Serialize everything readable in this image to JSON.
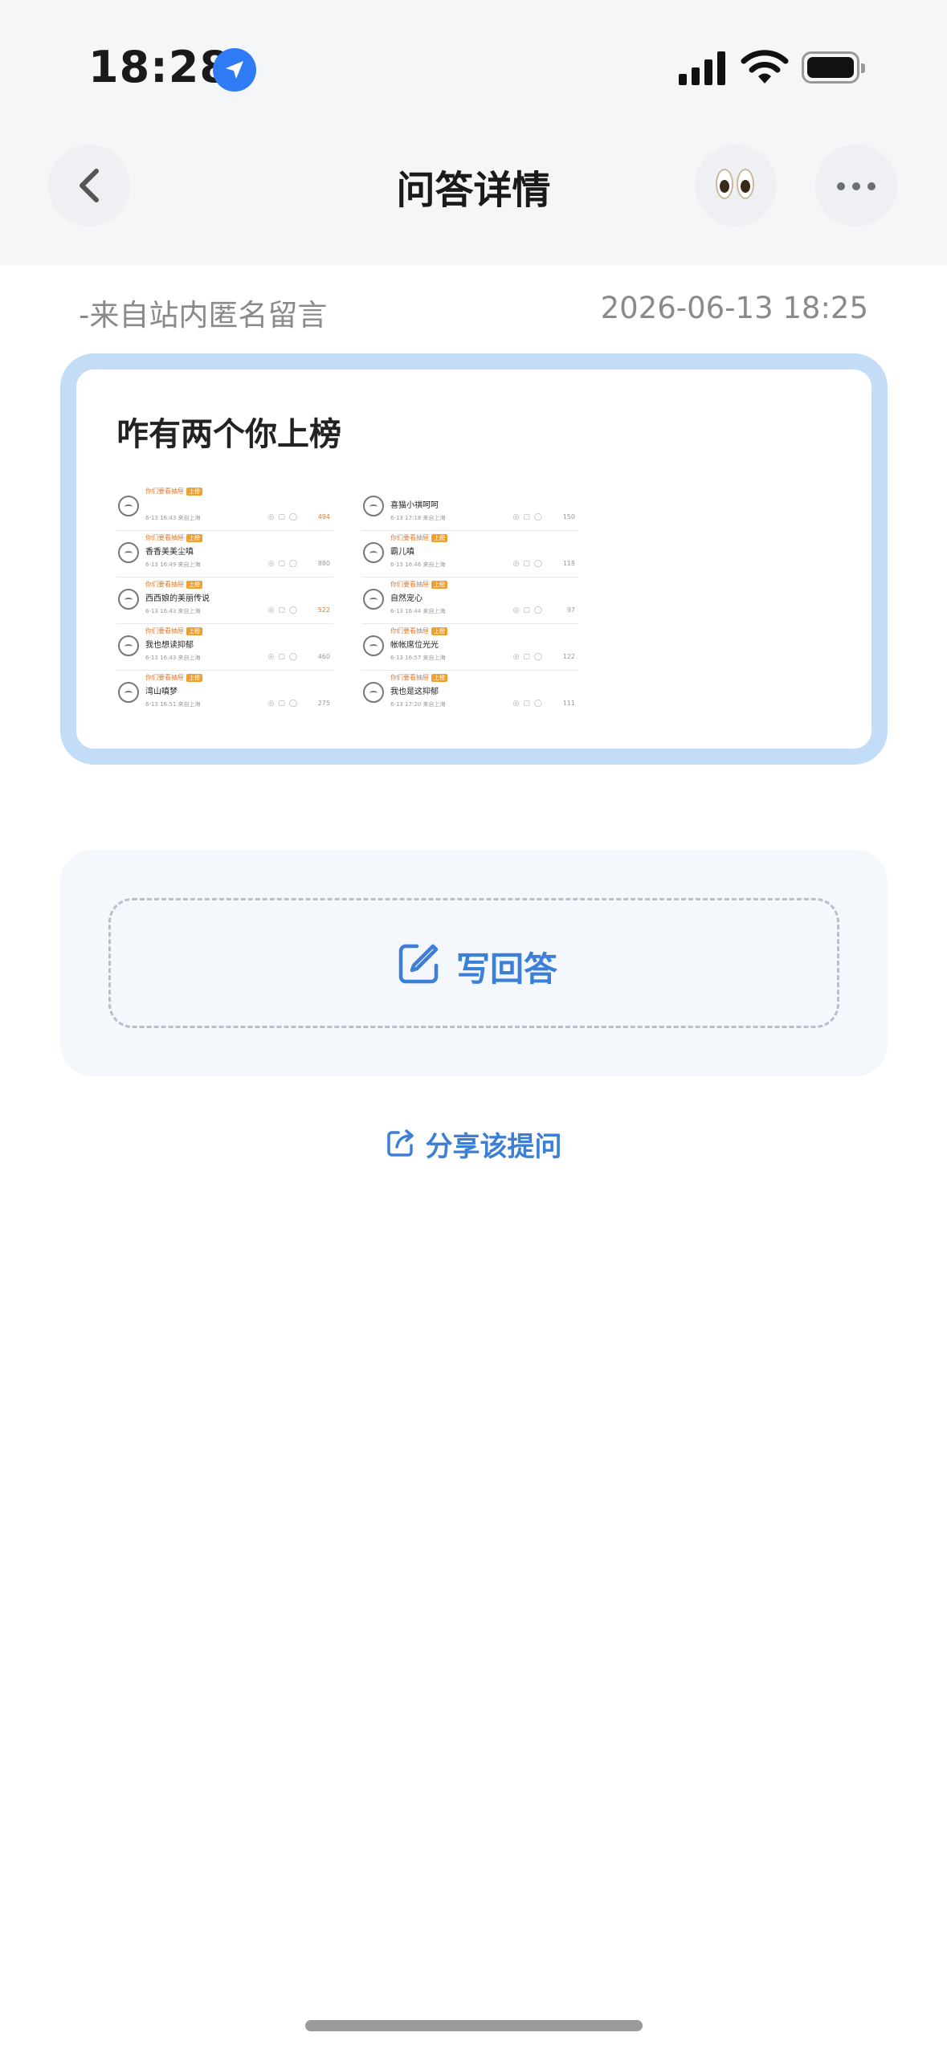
{
  "status": {
    "time": "18:28"
  },
  "nav": {
    "title": "问答详情"
  },
  "meta": {
    "source": "-来自站内匿名留言",
    "date": "2026-06-13 18:25"
  },
  "question": {
    "text": "咋有两个你上榜",
    "screenshot": {
      "left": [
        {
          "user": "你们要看抽屉",
          "text": "",
          "meta": "6-13 16:43 来自上海",
          "likes": "494",
          "hot": true
        },
        {
          "user": "你们要看抽屉",
          "text": "香香美美尘嗔",
          "meta": "6-13 16:49 来自上海",
          "likes": "880",
          "hot": false
        },
        {
          "user": "你们要看抽屉",
          "text": "西西娘的美丽传说",
          "meta": "6-13 16:43 来自上海",
          "likes": "522",
          "hot": true
        },
        {
          "user": "你们要看抽屉",
          "text": "我也想读抑郁",
          "meta": "6-13 16:43 来自上海",
          "likes": "460",
          "hot": false
        },
        {
          "user": "你们要看抽屉",
          "text": "湾山嗔梦",
          "meta": "6-13 16:51 来自上海",
          "likes": "275",
          "hot": false
        }
      ],
      "right": [
        {
          "user": "",
          "text": "喜猫小祺呵呵",
          "meta": "6-13 17:18 来自上海",
          "likes": "150",
          "hot": false
        },
        {
          "user": "你们要看抽屉",
          "text": "霸儿嗔",
          "meta": "6-13 16:46 来自上海",
          "likes": "118",
          "hot": false
        },
        {
          "user": "你们要看抽屉",
          "text": "自然宠心",
          "meta": "6-13 16:44 来自上海",
          "likes": "97",
          "hot": false
        },
        {
          "user": "你们要看抽屉",
          "text": "帐帐席位光光",
          "meta": "6-13 16:57 来自上海",
          "likes": "122",
          "hot": false
        },
        {
          "user": "你们要看抽屉",
          "text": "我也是这抑郁",
          "meta": "6-13 17:20 来自上海",
          "likes": "111",
          "hot": false
        }
      ],
      "badge": "上榜"
    }
  },
  "actions": {
    "answer_label": "写回答",
    "share_label": "分享该提问"
  },
  "colors": {
    "accent": "#3b7fd6",
    "card_border": "#c4ddf7"
  }
}
